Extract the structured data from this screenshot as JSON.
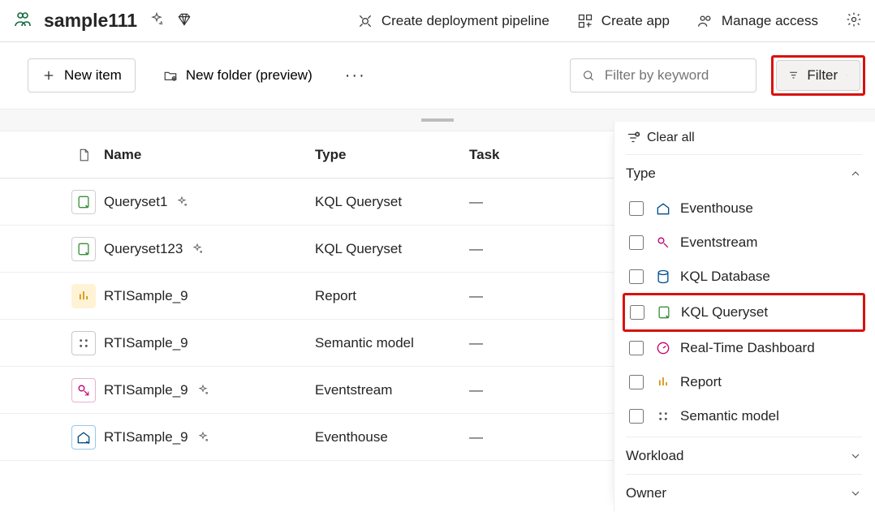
{
  "workspace": {
    "name": "sample111"
  },
  "topActions": {
    "pipeline": "Create deployment pipeline",
    "createApp": "Create app",
    "manageAccess": "Manage access"
  },
  "toolbar": {
    "newItem": "New item",
    "newFolder": "New folder (preview)",
    "searchPlaceholder": "Filter by keyword",
    "filter": "Filter"
  },
  "columns": {
    "name": "Name",
    "type": "Type",
    "task": "Task"
  },
  "rows": [
    {
      "icon": "queryset",
      "name": "Queryset1",
      "sparkle": true,
      "type": "KQL Queryset",
      "task": "—"
    },
    {
      "icon": "queryset",
      "name": "Queryset123",
      "sparkle": true,
      "type": "KQL Queryset",
      "task": "—"
    },
    {
      "icon": "report",
      "name": "RTISample_9",
      "sparkle": false,
      "type": "Report",
      "task": "—"
    },
    {
      "icon": "semantic",
      "name": "RTISample_9",
      "sparkle": false,
      "type": "Semantic model",
      "task": "—"
    },
    {
      "icon": "eventstream",
      "name": "RTISample_9",
      "sparkle": true,
      "type": "Eventstream",
      "task": "—"
    },
    {
      "icon": "eventhouse",
      "name": "RTISample_9",
      "sparkle": true,
      "type": "Eventhouse",
      "task": "—"
    }
  ],
  "filterPanel": {
    "clearAll": "Clear all",
    "sections": {
      "type": {
        "label": "Type",
        "items": [
          {
            "key": "eventhouse",
            "label": "Eventhouse"
          },
          {
            "key": "eventstream",
            "label": "Eventstream"
          },
          {
            "key": "kqldb",
            "label": "KQL Database"
          },
          {
            "key": "kqlqs",
            "label": "KQL Queryset",
            "highlight": true
          },
          {
            "key": "rtdash",
            "label": "Real-Time Dashboard"
          },
          {
            "key": "report",
            "label": "Report"
          },
          {
            "key": "semantic",
            "label": "Semantic model"
          }
        ]
      },
      "workload": {
        "label": "Workload"
      },
      "owner": {
        "label": "Owner"
      }
    }
  }
}
